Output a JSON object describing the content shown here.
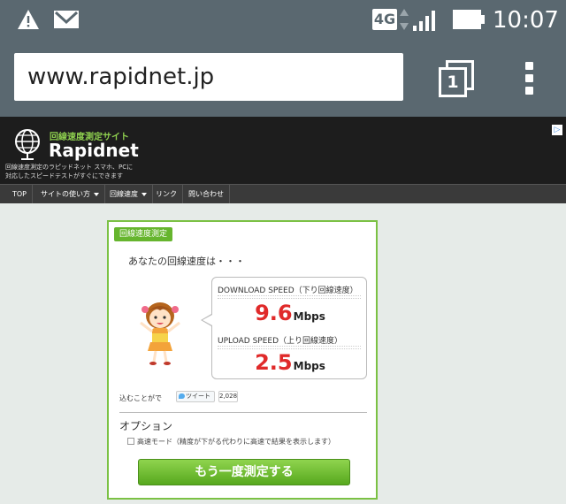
{
  "status_bar": {
    "network": "4G",
    "time": "10:07",
    "icons": [
      "warning-icon",
      "gmail-icon",
      "data-arrows-icon",
      "signal-icon",
      "battery-icon"
    ]
  },
  "browser": {
    "url": "www.rapidnet.jp",
    "tab_count": "1"
  },
  "site": {
    "tagline": "回線速度測定サイト",
    "name": "Rapidnet",
    "description": "回線速度測定のラピッドネット スマホ、PCに対応したスピードテストがすぐにできます",
    "ad_badge": "▷",
    "nav": [
      {
        "label": "TOP"
      },
      {
        "label": "サイトの使い方"
      },
      {
        "label": "回線速度"
      },
      {
        "label": "リンク"
      },
      {
        "label": "問い合わせ"
      }
    ]
  },
  "result": {
    "section_label": "回線速度測定",
    "intro": "あなたの回線速度は・・・",
    "download_label": "DOWNLOAD SPEED（下り回線速度）",
    "download_value": "9.6",
    "download_unit": "Mbps",
    "upload_label": "UPLOAD SPEED（上り回線速度）",
    "upload_value": "2.5",
    "upload_unit": "Mbps",
    "share_text": "込むことがで",
    "tweet_label": "ツイート",
    "tweet_count": "2,028",
    "option_title": "オプション",
    "option_label": "高速モード（精度が下がる代わりに高速で結果を表示します）",
    "retry_label": "もう一度測定する"
  },
  "colors": {
    "accent_green": "#66b52e",
    "speed_red": "#e02a2a",
    "chrome_gray": "#5a6870"
  }
}
